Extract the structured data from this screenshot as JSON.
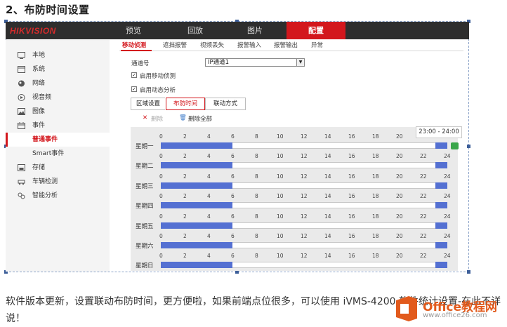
{
  "heading": "2、布防时间设置",
  "brand": {
    "logo": "HIKVISION",
    "accent": "#d3171d"
  },
  "nav": [
    "预览",
    "回放",
    "图片",
    "配置"
  ],
  "nav_active": 3,
  "sidebar": {
    "items": [
      {
        "label": "本地",
        "icon": "monitor-icon"
      },
      {
        "label": "系统",
        "icon": "system-icon"
      },
      {
        "label": "网络",
        "icon": "globe-icon"
      },
      {
        "label": "视音频",
        "icon": "audio-video-icon"
      },
      {
        "label": "图像",
        "icon": "image-icon"
      },
      {
        "label": "事件",
        "icon": "calendar-icon"
      },
      {
        "label": "普通事件",
        "icon": ""
      },
      {
        "label": "Smart事件",
        "icon": ""
      },
      {
        "label": "存储",
        "icon": "storage-icon"
      },
      {
        "label": "车辆检测",
        "icon": "car-icon"
      },
      {
        "label": "智能分析",
        "icon": "analysis-icon"
      }
    ],
    "active_index": 6
  },
  "subtabs": [
    "移动侦测",
    "遮挡报警",
    "视频丢失",
    "报警输入",
    "报警输出",
    "异常"
  ],
  "form": {
    "channel_label": "通道号",
    "channel_value": "IP通道1",
    "enable_motion": "启用移动侦测",
    "enable_dynamic": "启用动态分析"
  },
  "crumbs": [
    "区域设置",
    "布防时间",
    "联动方式"
  ],
  "toolbar": {
    "delete": "删除",
    "delete_all": "删除全部"
  },
  "schedule": {
    "days": [
      "星期一",
      "星期二",
      "星期三",
      "星期四",
      "星期五",
      "星期六",
      "星期日"
    ],
    "ticks": [
      "0",
      "2",
      "4",
      "6",
      "8",
      "10",
      "12",
      "14",
      "16",
      "18",
      "20",
      "22",
      "24"
    ],
    "segments": [
      [
        [
          0,
          6
        ],
        [
          23,
          24
        ]
      ],
      [
        [
          0,
          6
        ],
        [
          23,
          24
        ]
      ],
      [
        [
          0,
          6
        ],
        [
          23,
          24
        ]
      ],
      [
        [
          0,
          6
        ],
        [
          23,
          24
        ]
      ],
      [
        [
          0,
          6
        ],
        [
          23,
          24
        ]
      ],
      [
        [
          0,
          6
        ],
        [
          23,
          24
        ]
      ],
      [
        [
          0,
          6
        ],
        [
          23,
          24
        ]
      ]
    ],
    "tooltip": "23:00 - 24:00",
    "bar_color": "#5470d2"
  },
  "note": "软件版本更新，设置联动布防时间，更方便啦，如果前端点位很多，可以使用 iVMS-4200 软件统计设置-在此不详说！",
  "watermark": {
    "line1": "Office教程网",
    "line2": "www.office26.com"
  }
}
